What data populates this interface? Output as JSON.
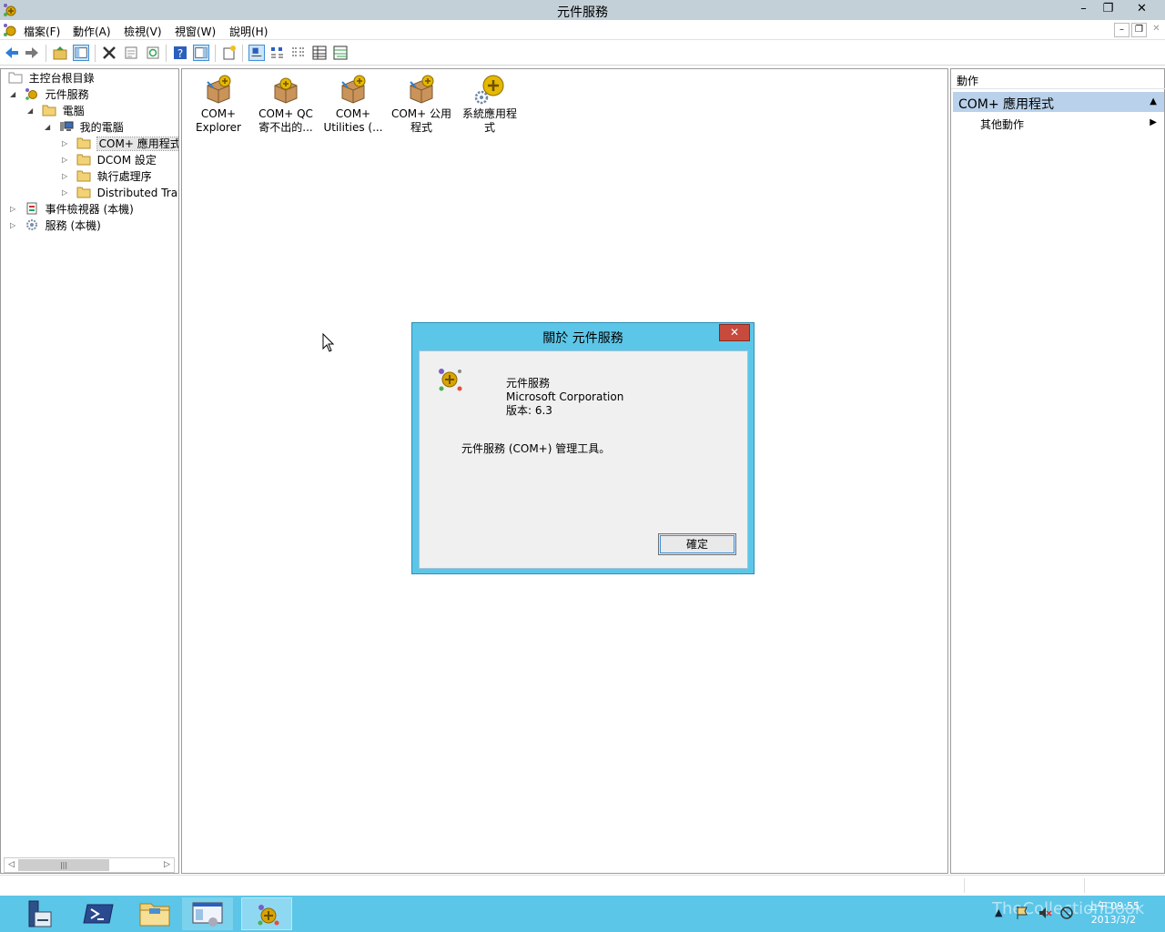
{
  "window": {
    "title": "元件服務",
    "minimize": "–",
    "restore": "❐",
    "close": "✕"
  },
  "menu": {
    "items": [
      "檔案(F)",
      "動作(A)",
      "檢視(V)",
      "視窗(W)",
      "說明(H)"
    ],
    "mdi_min": "–",
    "mdi_restore": "❐",
    "mdi_close": "✕"
  },
  "tree": {
    "items": [
      {
        "label": "主控台根目錄",
        "arrow": ""
      },
      {
        "label": "元件服務",
        "arrow": "◢"
      },
      {
        "label": "電腦",
        "arrow": "◢"
      },
      {
        "label": "我的電腦",
        "arrow": "◢"
      },
      {
        "label": "COM+ 應用程式",
        "arrow": "▷"
      },
      {
        "label": "DCOM 設定",
        "arrow": "▷"
      },
      {
        "label": "執行處理序",
        "arrow": "▷"
      },
      {
        "label": "Distributed Transaction Coordinator",
        "arrow": "▷"
      },
      {
        "label": "事件檢視器 (本機)",
        "arrow": "▷"
      },
      {
        "label": "服務 (本機)",
        "arrow": "▷"
      }
    ],
    "scroll_left": "◁",
    "scroll_right": "▷",
    "scroll_grip": "|||"
  },
  "center": {
    "items": [
      {
        "line1": "COM+",
        "line2": "Explorer"
      },
      {
        "line1": "COM+ QC",
        "line2": "寄不出的..."
      },
      {
        "line1": "COM+",
        "line2": "Utilities (..."
      },
      {
        "line1": "COM+ 公用",
        "line2": "程式"
      },
      {
        "line1": "系統應用程",
        "line2": "式"
      }
    ]
  },
  "actions": {
    "header": "動作",
    "section": "COM+ 應用程式",
    "collapse": "▲",
    "more_actions": "其他動作",
    "more_arrow": "▶"
  },
  "dialog": {
    "title": "關於 元件服務",
    "close": "✕",
    "product": "元件服務",
    "company": "Microsoft Corporation",
    "version": "版本: 6.3",
    "description": "元件服務 (COM+) 管理工具。",
    "ok": "確定"
  },
  "taskbar": {
    "clock_time": "上午 09:55",
    "clock_date": "2013/3/2",
    "tray_up": "▲",
    "watermark": "TheCollectionBook"
  },
  "colors": {
    "titlebar": "#c3d0d8",
    "taskbar": "#5cc6e8",
    "dialog_frame": "#5cc6e8",
    "close_button": "#c74a3d",
    "action_section": "#b9d1ea"
  }
}
